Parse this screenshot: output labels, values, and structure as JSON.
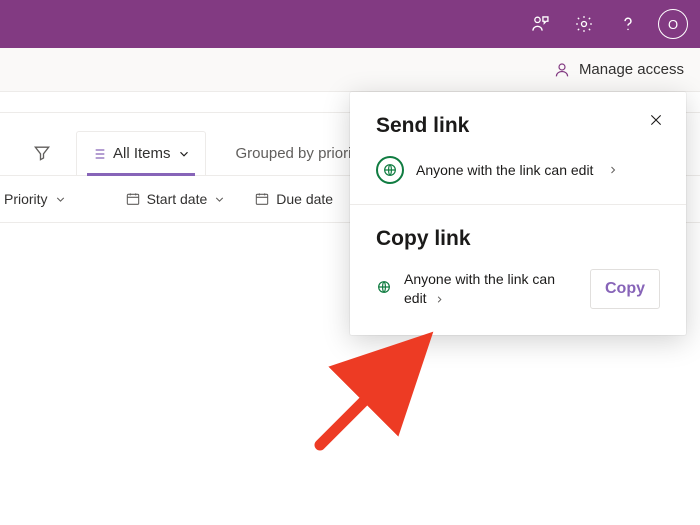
{
  "topbar": {
    "avatar_initial": "O"
  },
  "actionbar": {
    "manage_access_label": "Manage access"
  },
  "views": {
    "filter_icon": "filter",
    "active_tab_label": "All Items",
    "secondary_tab_label": "Grouped by priority"
  },
  "columns": {
    "priority": "Priority",
    "start_date": "Start date",
    "due_date": "Due date"
  },
  "share_popup": {
    "send_title": "Send link",
    "send_scope": "Anyone with the link can edit",
    "copy_title": "Copy link",
    "copy_scope": "Anyone with the link can edit",
    "copy_button": "Copy"
  }
}
